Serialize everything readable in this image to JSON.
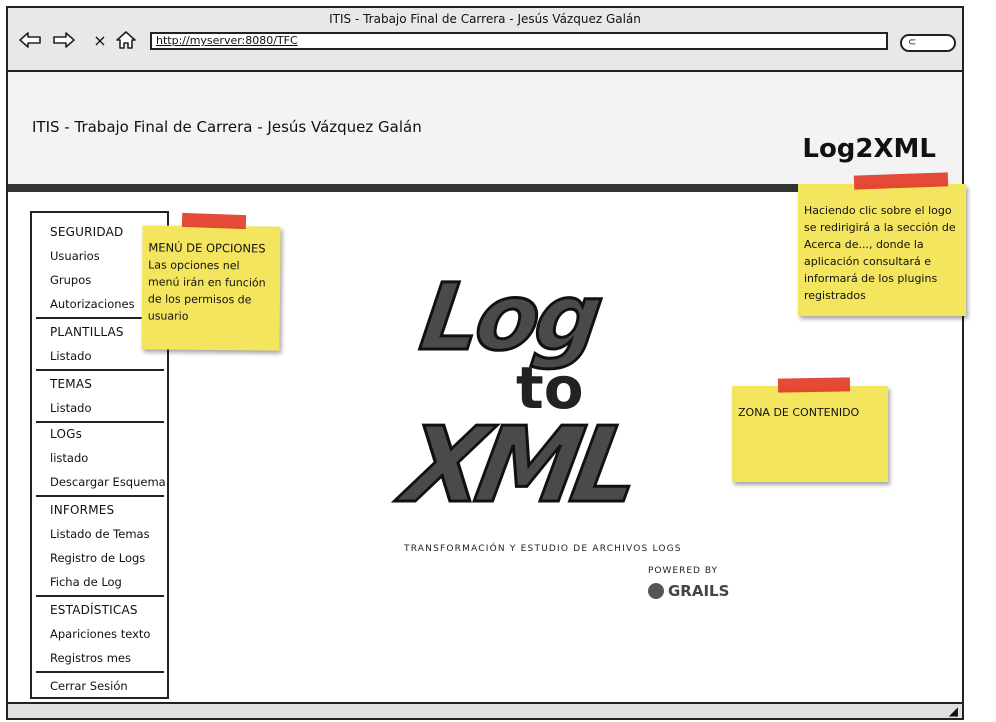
{
  "window": {
    "title": "ITIS - Trabajo Final de Carrera -  Jesús Vázquez Galán"
  },
  "browser": {
    "url": "http://myserver:8080/TFC",
    "close_glyph": "×",
    "search_glyph": "⊂"
  },
  "header": {
    "title": "ITIS - Trabajo Final de Carrera - Jesús Vázquez Galán",
    "logo_label": "Log2XML"
  },
  "menu": {
    "sections": [
      {
        "title": "SEGURIDAD",
        "items": [
          "Usuarios",
          "Grupos",
          "Autorizaciones"
        ]
      },
      {
        "title": "PLANTILLAS",
        "items": [
          "Listado"
        ]
      },
      {
        "title": "TEMAS",
        "items": [
          "Listado"
        ]
      },
      {
        "title": "LOGs",
        "items": [
          "listado",
          "Descargar Esquema"
        ]
      },
      {
        "title": "INFORMES",
        "items": [
          "Listado de Temas",
          "Registro de Logs",
          "Ficha de Log"
        ]
      },
      {
        "title": "ESTADÍSTICAS",
        "items": [
          "Apariciones texto",
          "Registros mes"
        ]
      }
    ],
    "logout": "Cerrar Sesión"
  },
  "notes": {
    "menu_note_title": "MENÚ DE OPCIONES",
    "menu_note_body": "Las opciones nel menú irán en función de los permisos de usuario",
    "logo_note_body": "Haciendo clic sobre el logo se redirigirá a la sección de Acerca de..., donde la aplicación consultará e informará de los plugins registrados",
    "content_note_title": "ZONA DE CONTENIDO"
  },
  "logo": {
    "line1": "Log",
    "line2": "to",
    "line3": "XML",
    "subtitle": "Transformación y Estudio de Archivos Logs",
    "powered_by": "Powered by",
    "grails": "GRAILS"
  },
  "colors": {
    "sticky": "#f4e55f",
    "tape": "#e23c2a",
    "chrome": "#e8e8e8"
  },
  "icons": {
    "back": "back-arrow-icon",
    "forward": "forward-arrow-icon",
    "home": "home-icon",
    "search": "search-icon",
    "resize": "resize-grip-icon"
  }
}
